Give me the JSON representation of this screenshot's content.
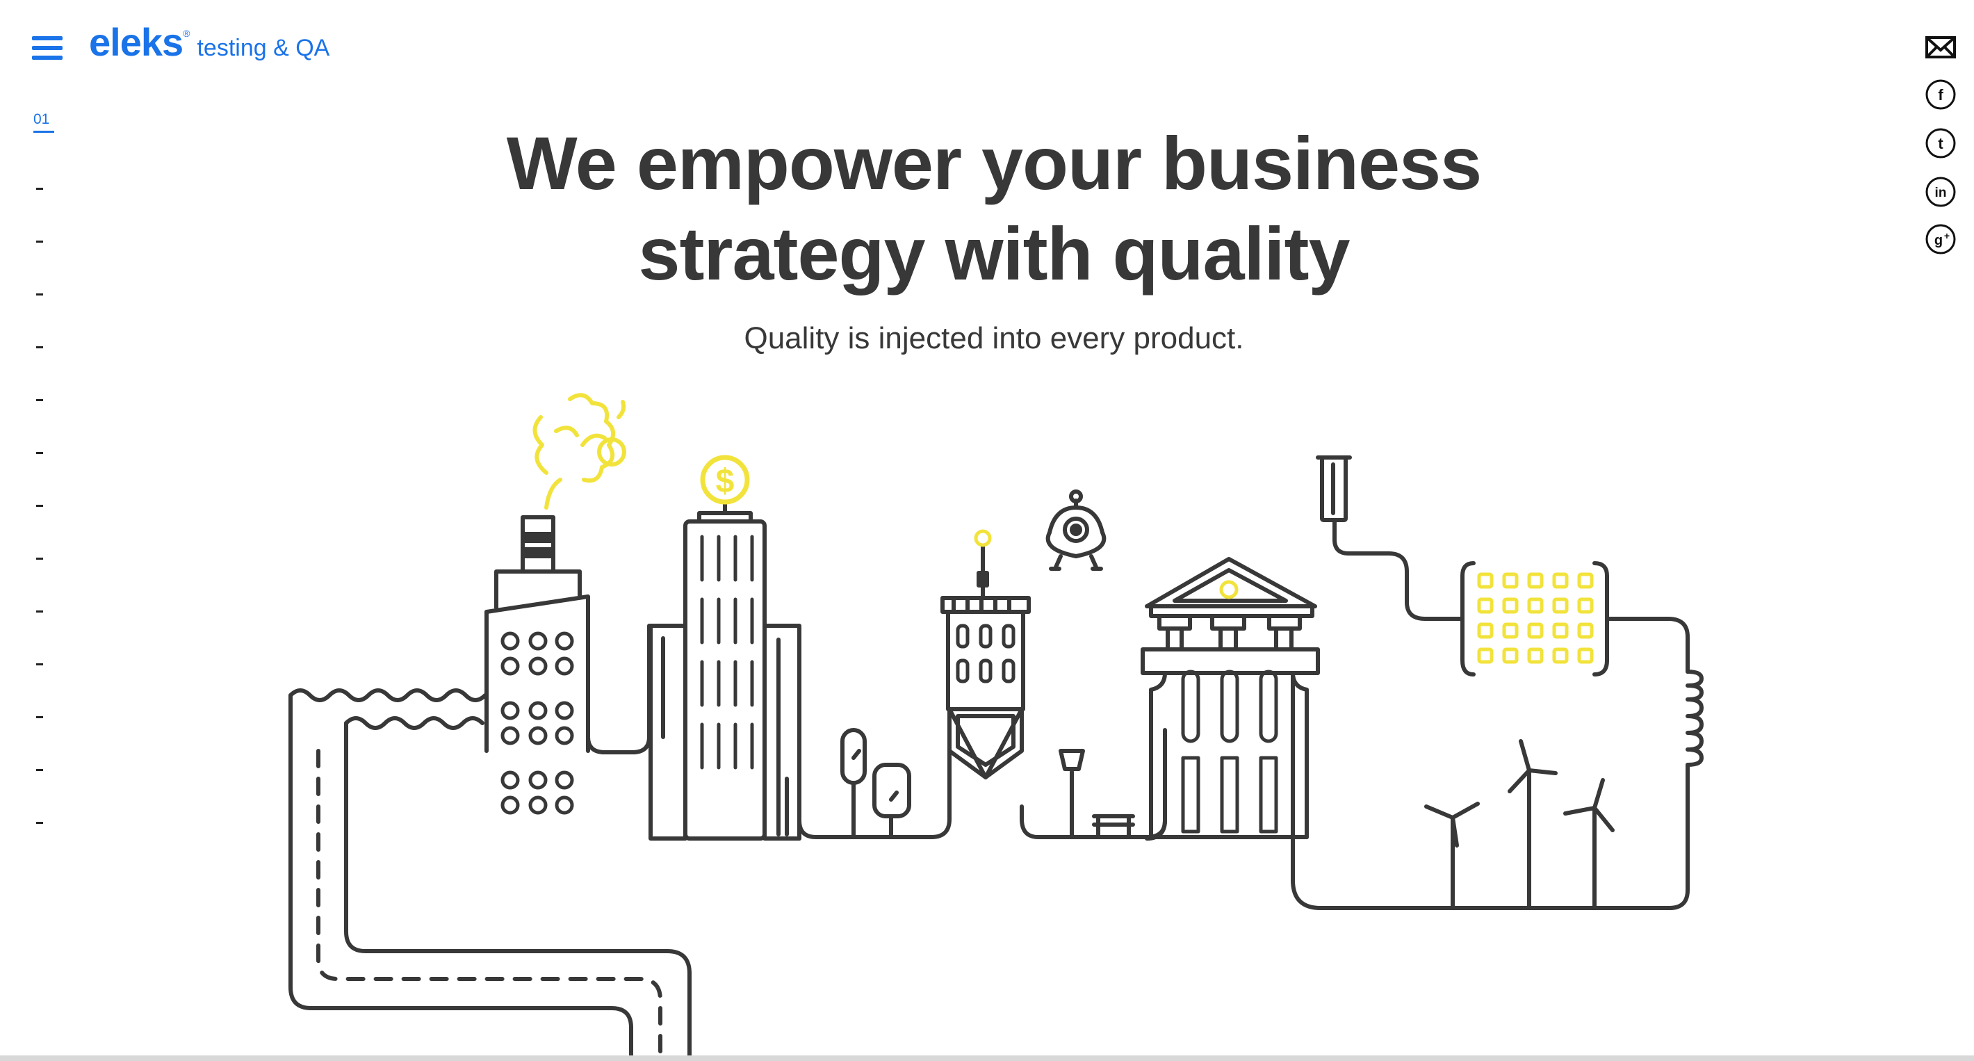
{
  "header": {
    "brand": "eleks",
    "brand_mark": "®",
    "tagline": "testing & QA"
  },
  "pager": {
    "current": "01",
    "total_remaining": 13
  },
  "hero": {
    "title_line1": "We empower your business",
    "title_line2": "strategy with quality",
    "subtitle": "Quality is injected into every product."
  },
  "social": [
    {
      "name": "email-icon"
    },
    {
      "name": "facebook-icon"
    },
    {
      "name": "tumblr-icon"
    },
    {
      "name": "linkedin-icon"
    },
    {
      "name": "google-plus-icon"
    }
  ],
  "colors": {
    "brand_blue": "#1a73e8",
    "line_dark": "#383838",
    "accent_yellow": "#f2e33c"
  }
}
